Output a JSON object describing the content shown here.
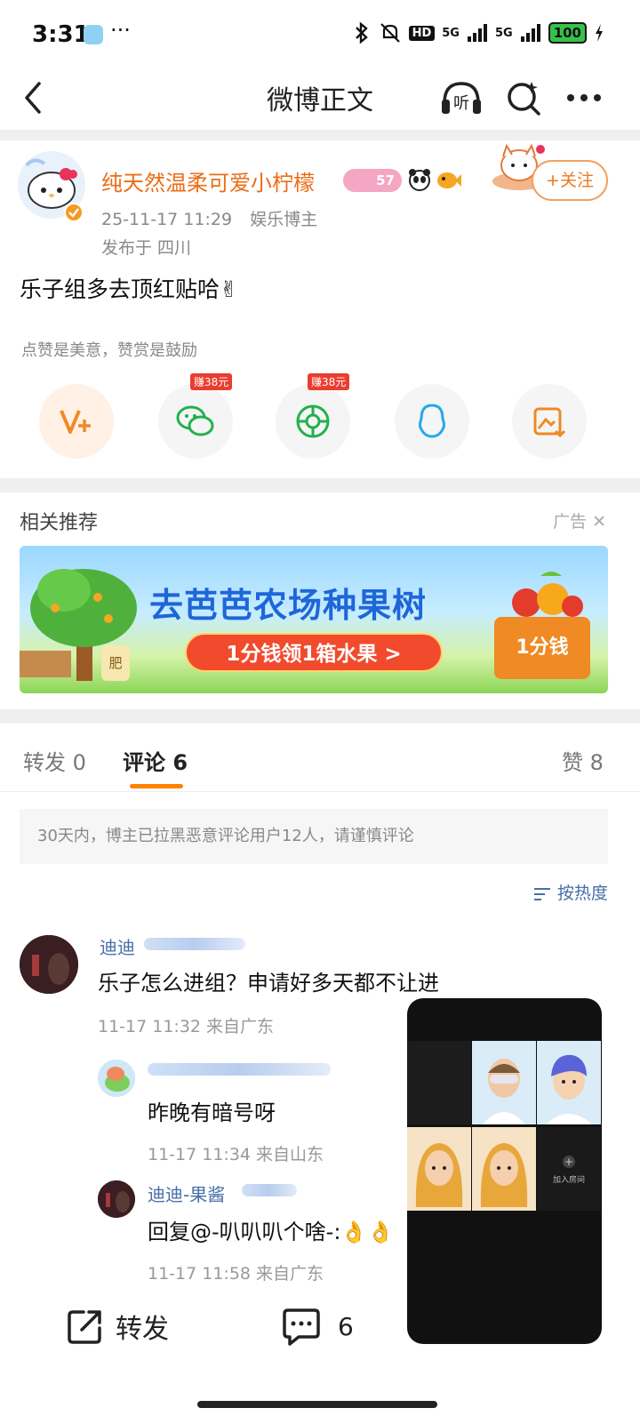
{
  "status_bar": {
    "time": "3:31",
    "dots": "···",
    "hd": "HD",
    "network1": "5G",
    "network2": "5G",
    "battery": "100"
  },
  "nav": {
    "title": "微博正文"
  },
  "post": {
    "author": "纯天然温柔可爱小柠檬",
    "level_badge": "57",
    "time": "25-11-17 11:29",
    "role": "娱乐博主",
    "location": "发布于 四川",
    "text": "乐子组多去顶红贴哈✌",
    "follow": "+关注",
    "hint": "点赞是美意，赞赏是鼓励",
    "reward1": "赚38元",
    "reward2": "赚38元"
  },
  "recommend": {
    "title": "相关推荐",
    "ad_label": "广告",
    "banner_headline": "去芭芭农场种果树",
    "banner_button": "1分钱领1箱水果 >",
    "banner_box": "1分钱",
    "fertilizer": "肥"
  },
  "tabs": {
    "repost": "转发 0",
    "comment": "评论 6",
    "like": "赞 8"
  },
  "notice": "30天内，博主已拉黑恶意评论用户12人，请谨慎评论",
  "sort_label": "按热度",
  "comments": [
    {
      "name": "迪迪",
      "text": "乐子怎么进组？申请好多天都不让进",
      "time": "11-17 11:32  来自广东"
    }
  ],
  "replies": [
    {
      "text": "昨晚有暗号呀",
      "time": "11-17 11:34  来自山东"
    },
    {
      "name": "迪迪-果酱",
      "text": "回复@-叭叭叭个啥-:👌👌",
      "time": "11-17 11:58  来自广东"
    }
  ],
  "bottom": {
    "repost": "转发",
    "comment_count": "6"
  },
  "float_panel": {
    "invite": "加入房间"
  },
  "colors": {
    "accent": "#ff8200",
    "link": "#476ea8",
    "author": "#ec6c15"
  }
}
